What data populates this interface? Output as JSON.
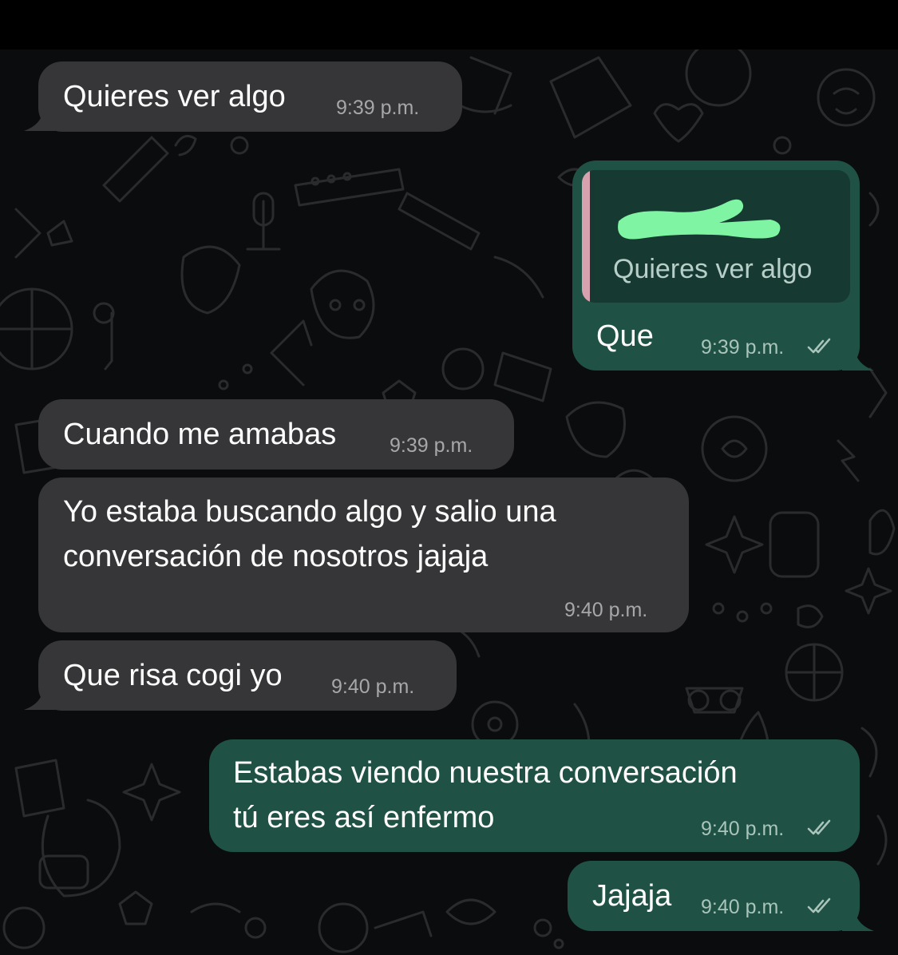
{
  "theme": {
    "incoming_bubble": "#363638",
    "outgoing_bubble": "#1f5245",
    "quote_bar_color": "#d7a2b0",
    "redaction_color": "#7ff5a4",
    "read_ticks": "double-check-icon"
  },
  "messages": [
    {
      "direction": "incoming",
      "text": "Quieres ver algo",
      "time": "9:39 p.m."
    },
    {
      "direction": "outgoing",
      "quoted_text": "Quieres ver algo",
      "quoted_author": "[redacted]",
      "text": "Que",
      "time": "9:39 p.m.",
      "status": "read"
    },
    {
      "direction": "incoming",
      "text": "Cuando me amabas",
      "time": "9:39 p.m."
    },
    {
      "direction": "incoming",
      "lines": [
        "Yo estaba buscando algo y salio una",
        "conversación de nosotros jajaja"
      ],
      "time": "9:40 p.m."
    },
    {
      "direction": "incoming",
      "text": "Que risa cogi yo",
      "time": "9:40 p.m."
    },
    {
      "direction": "outgoing",
      "lines": [
        "Estabas viendo nuestra conversación",
        "tú eres así enfermo"
      ],
      "time": "9:40 p.m.",
      "status": "read"
    },
    {
      "direction": "outgoing",
      "text": "Jajaja",
      "time": "9:40 p.m.",
      "status": "read"
    }
  ]
}
